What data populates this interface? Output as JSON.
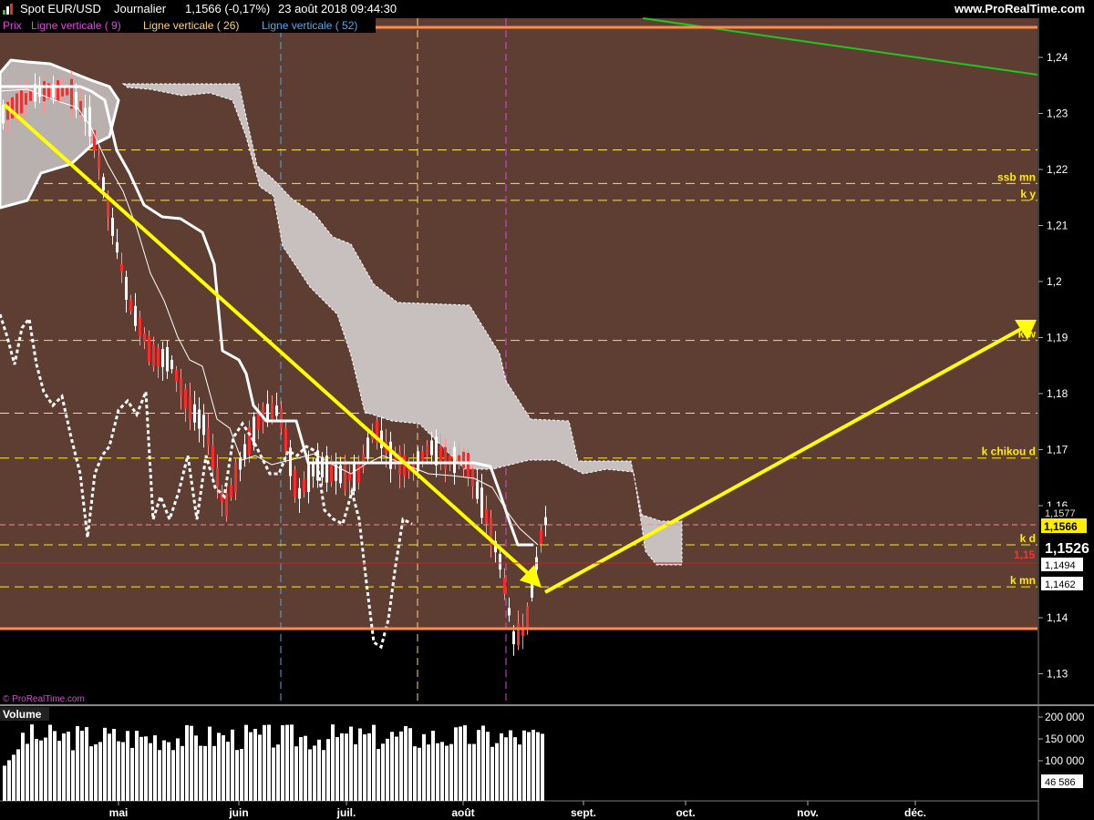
{
  "window": {
    "instrument": "Spot EUR/USD",
    "period": "Journalier",
    "price_change": "1,1566 (-0,17%)",
    "datetime": "23 août 2018 09:44:30",
    "brand": "www.ProRealTime.com"
  },
  "legend": {
    "prix": "Prix",
    "lv9": "Ligne verticale ( 9)",
    "lv26": "Ligne verticale ( 26)",
    "lv52": "Ligne verticale ( 52)"
  },
  "watermark": "© ProRealTime.com",
  "volume_title": "Volume",
  "price_axis": [
    {
      "v": 1.24,
      "label": "1,24"
    },
    {
      "v": 1.23,
      "label": "1,23"
    },
    {
      "v": 1.22,
      "label": "1,22"
    },
    {
      "v": 1.21,
      "label": "1,21"
    },
    {
      "v": 1.2,
      "label": "1,2"
    },
    {
      "v": 1.19,
      "label": "1,19"
    },
    {
      "v": 1.18,
      "label": "1,18"
    },
    {
      "v": 1.17,
      "label": "1,17"
    },
    {
      "v": 1.16,
      "label": "1,16"
    },
    {
      "v": 1.14,
      "label": "1,14"
    },
    {
      "v": 1.13,
      "label": "1,13"
    }
  ],
  "volume_axis": [
    "200 000",
    "150 000",
    "100 000"
  ],
  "x_axis": [
    "mai",
    "juin",
    "juil.",
    "août",
    "sept.",
    "oct.",
    "nov.",
    "déc."
  ],
  "levels": [
    {
      "v": 1.2175,
      "label": "ssb mn"
    },
    {
      "v": 1.2145,
      "label": "k y"
    },
    {
      "v": 1.1895,
      "label": "k w"
    },
    {
      "v": 1.1685,
      "label": "k chikou d"
    },
    {
      "v": 1.153,
      "label": "k d"
    },
    {
      "v": 1.1455,
      "label": "k mn"
    }
  ],
  "untagged_levels": [
    1.2235,
    1.1765
  ],
  "price_boxes": {
    "b1577": "1,1577",
    "current": "1,1566",
    "b15": "1,15",
    "b1526": "1,1526",
    "b1494": "1,1494",
    "b1462": "1,1462",
    "volume_last": "46 586"
  },
  "colors": {
    "background": "#5e3e32",
    "bear": "#ff2a2a",
    "bull": "#ffffff",
    "level": "#ffee00",
    "orange_line": "#ff8a4a",
    "green_line": "#1ec71e",
    "yellow_arrow": "#ffff00",
    "vline9": "#e045e0",
    "vline26": "#ffcf80",
    "vline52": "#55a8e8"
  }
}
